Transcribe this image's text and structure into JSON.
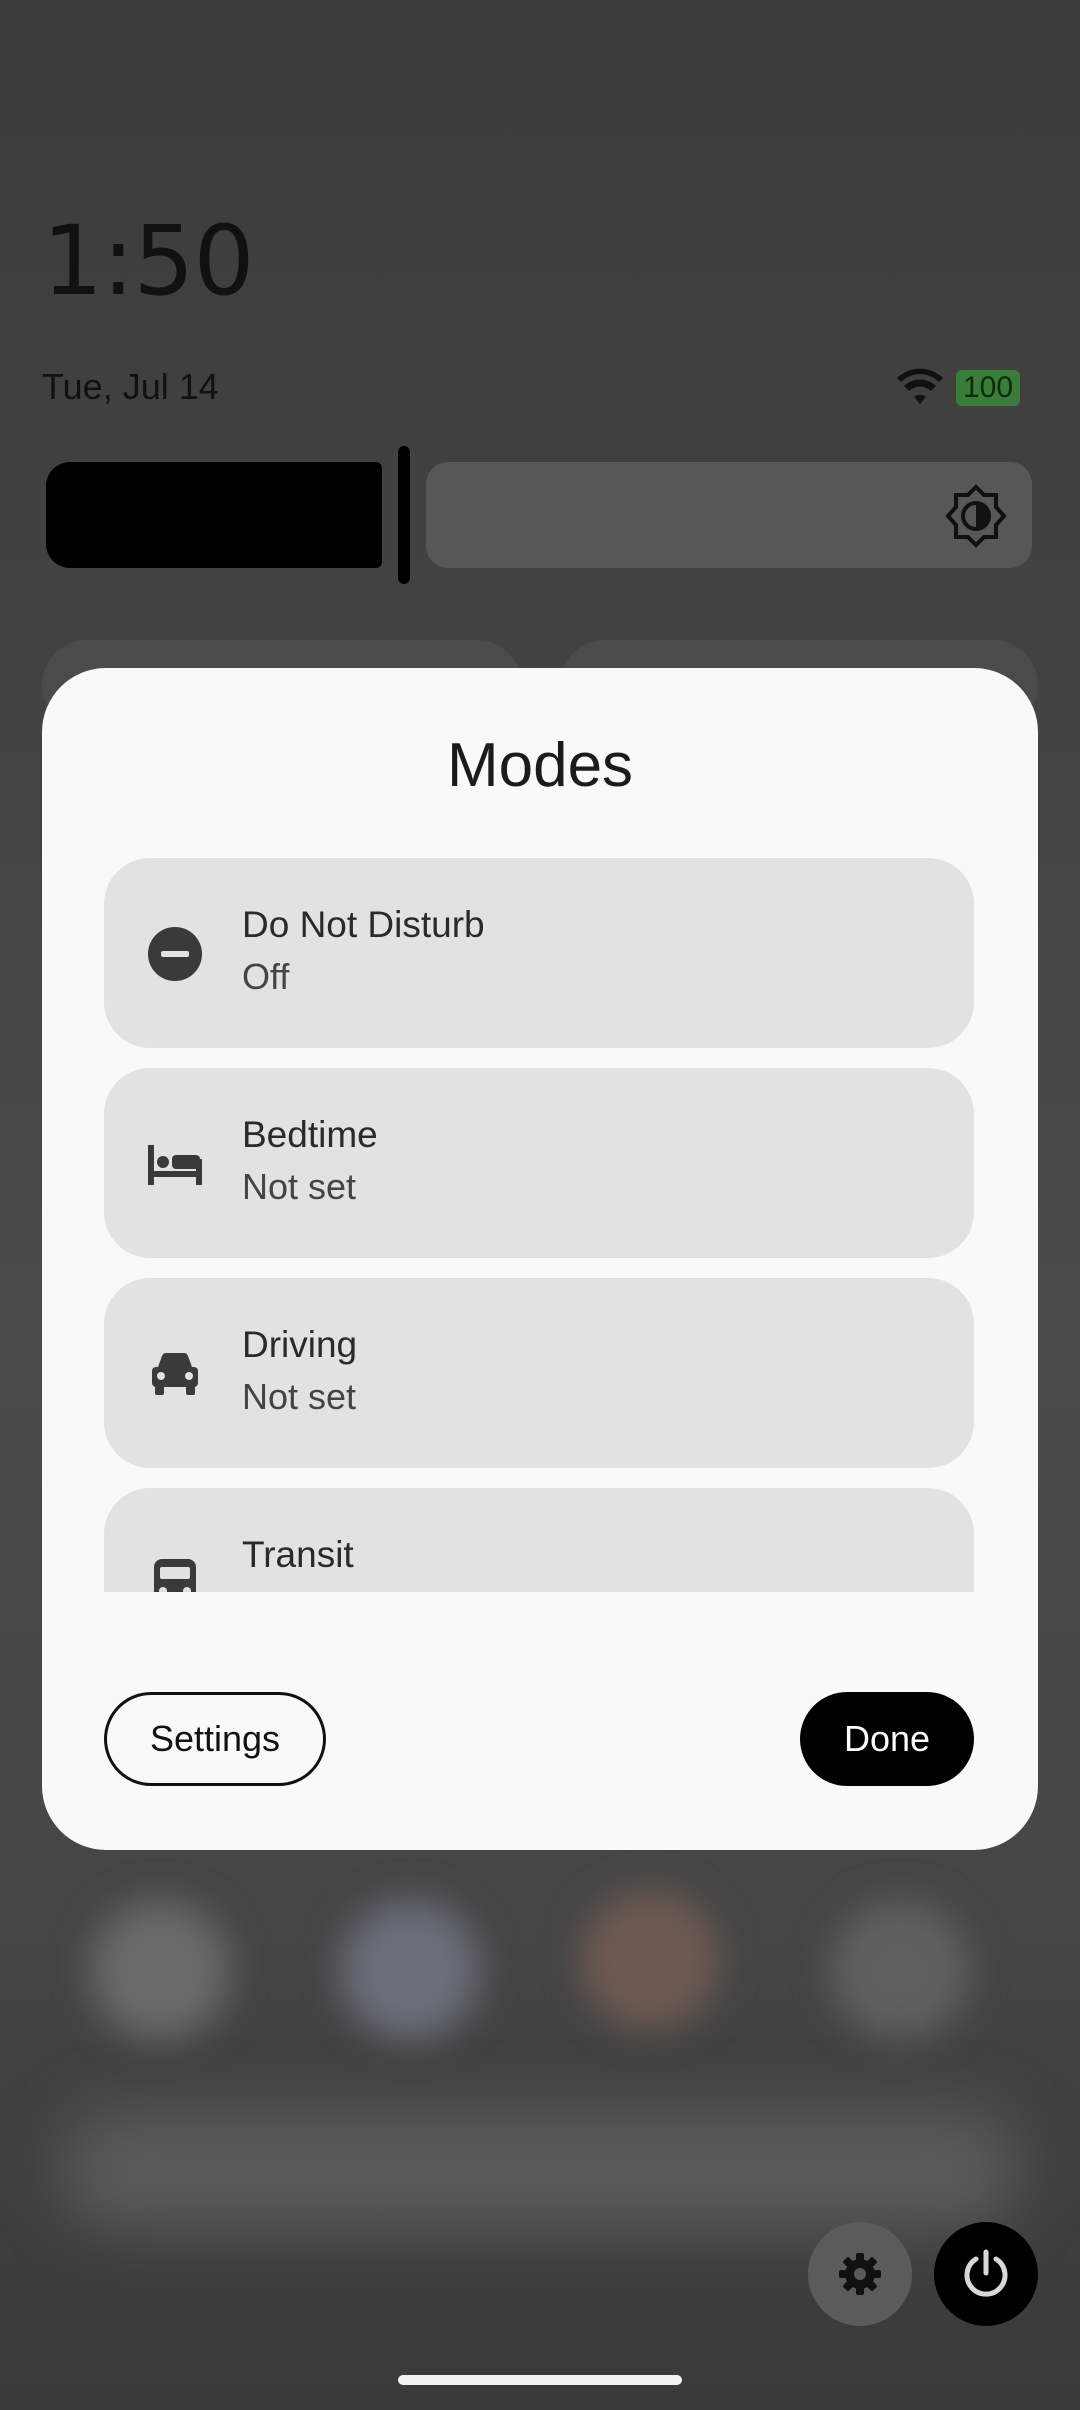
{
  "status": {
    "time": "1:50",
    "date": "Tue, Jul 14",
    "battery": "100"
  },
  "dialog": {
    "title": "Modes",
    "modes": [
      {
        "name": "Do Not Disturb",
        "status": "Off",
        "icon": "do-not-disturb-icon"
      },
      {
        "name": "Bedtime",
        "status": "Not set",
        "icon": "bed-icon"
      },
      {
        "name": "Driving",
        "status": "Not set",
        "icon": "car-icon"
      },
      {
        "name": "Transit",
        "status": "",
        "icon": "bus-icon"
      }
    ],
    "settings_label": "Settings",
    "done_label": "Done"
  },
  "colors": {
    "dialog_bg": "#f9f9f9",
    "mode_item_bg": "#e2e2e2",
    "primary_button": "#000000",
    "battery": "#3a7d3a"
  }
}
